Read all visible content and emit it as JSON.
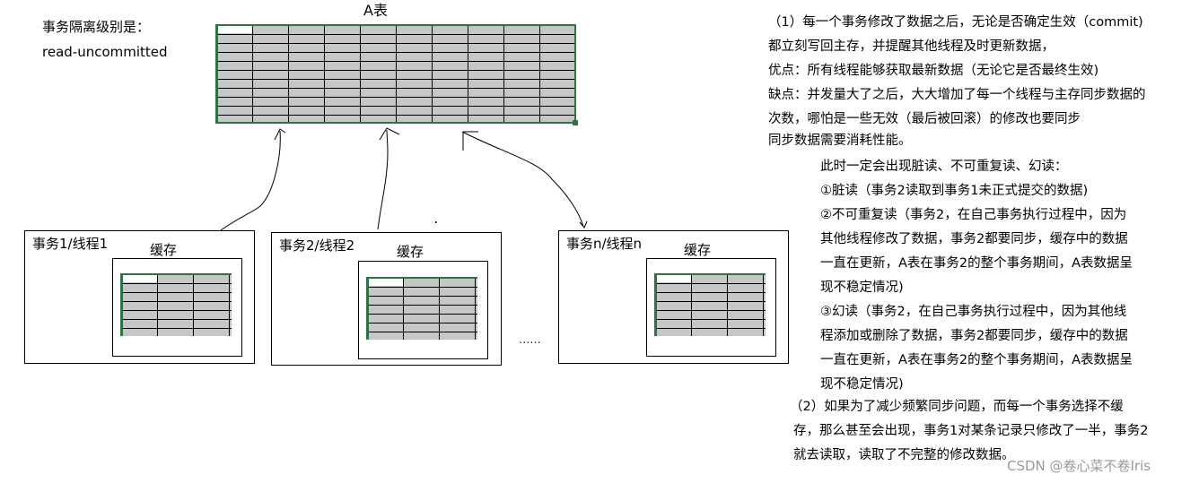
{
  "isolation": {
    "title": "事务隔离级别是：",
    "value": "read-uncommitted"
  },
  "main_table": {
    "title": "A表",
    "columns": 10,
    "rows": 11
  },
  "threads": [
    {
      "title": "事务1/线程1",
      "cache_label": "缓存"
    },
    {
      "title": "事务2/线程2",
      "cache_label": "缓存"
    },
    {
      "title": "事务n/线程n",
      "cache_label": "缓存"
    }
  ],
  "ellipsis": "......",
  "notes": {
    "section1": [
      "（1）每一个事务修改了数据之后，无论是否确定生效（commit)",
      "都立刻写回主存，并提醒其他线程及时更新数据，",
      "优点：所有线程能够获取最新数据（无论它是否最终生效)",
      "缺点：并发量大了之后，大大增加了每一个线程与主存同步数据的",
      "次数，哪怕是一些无效（最后被回滚）的修改也要同步",
      "同步数据需要消耗性能。"
    ],
    "anomalies": [
      "此时一定会出现脏读、不可重复读、幻读：",
      "①脏读（事务2读取到事务1未正式提交的数据)",
      "②不可重复读（事务2，在自己事务执行过程中，因为",
      "其他线程修改了数据，事务2都要同步，缓存中的数据",
      "一直在更新，A表在事务2的整个事务期间，A表数据呈",
      "现不稳定情况)",
      "③幻读（事务2，在自己事务执行过程中，因为其他线",
      "程添加或删除了数据，事务2都要同步，缓存中的数据",
      "一直在更新，A表在事务2的整个事务期间，A表数据呈",
      "现不稳定情况)"
    ],
    "section2": [
      "（2）如果为了减少频繁同步问题，而每一个事务选择不缓",
      "存，那么甚至会出现，事务1对某条记录只修改了一半，事务2",
      "就去读取，读取了不完整的修改数据。"
    ]
  },
  "watermark": "CSDN @卷心菜不卷Iris"
}
